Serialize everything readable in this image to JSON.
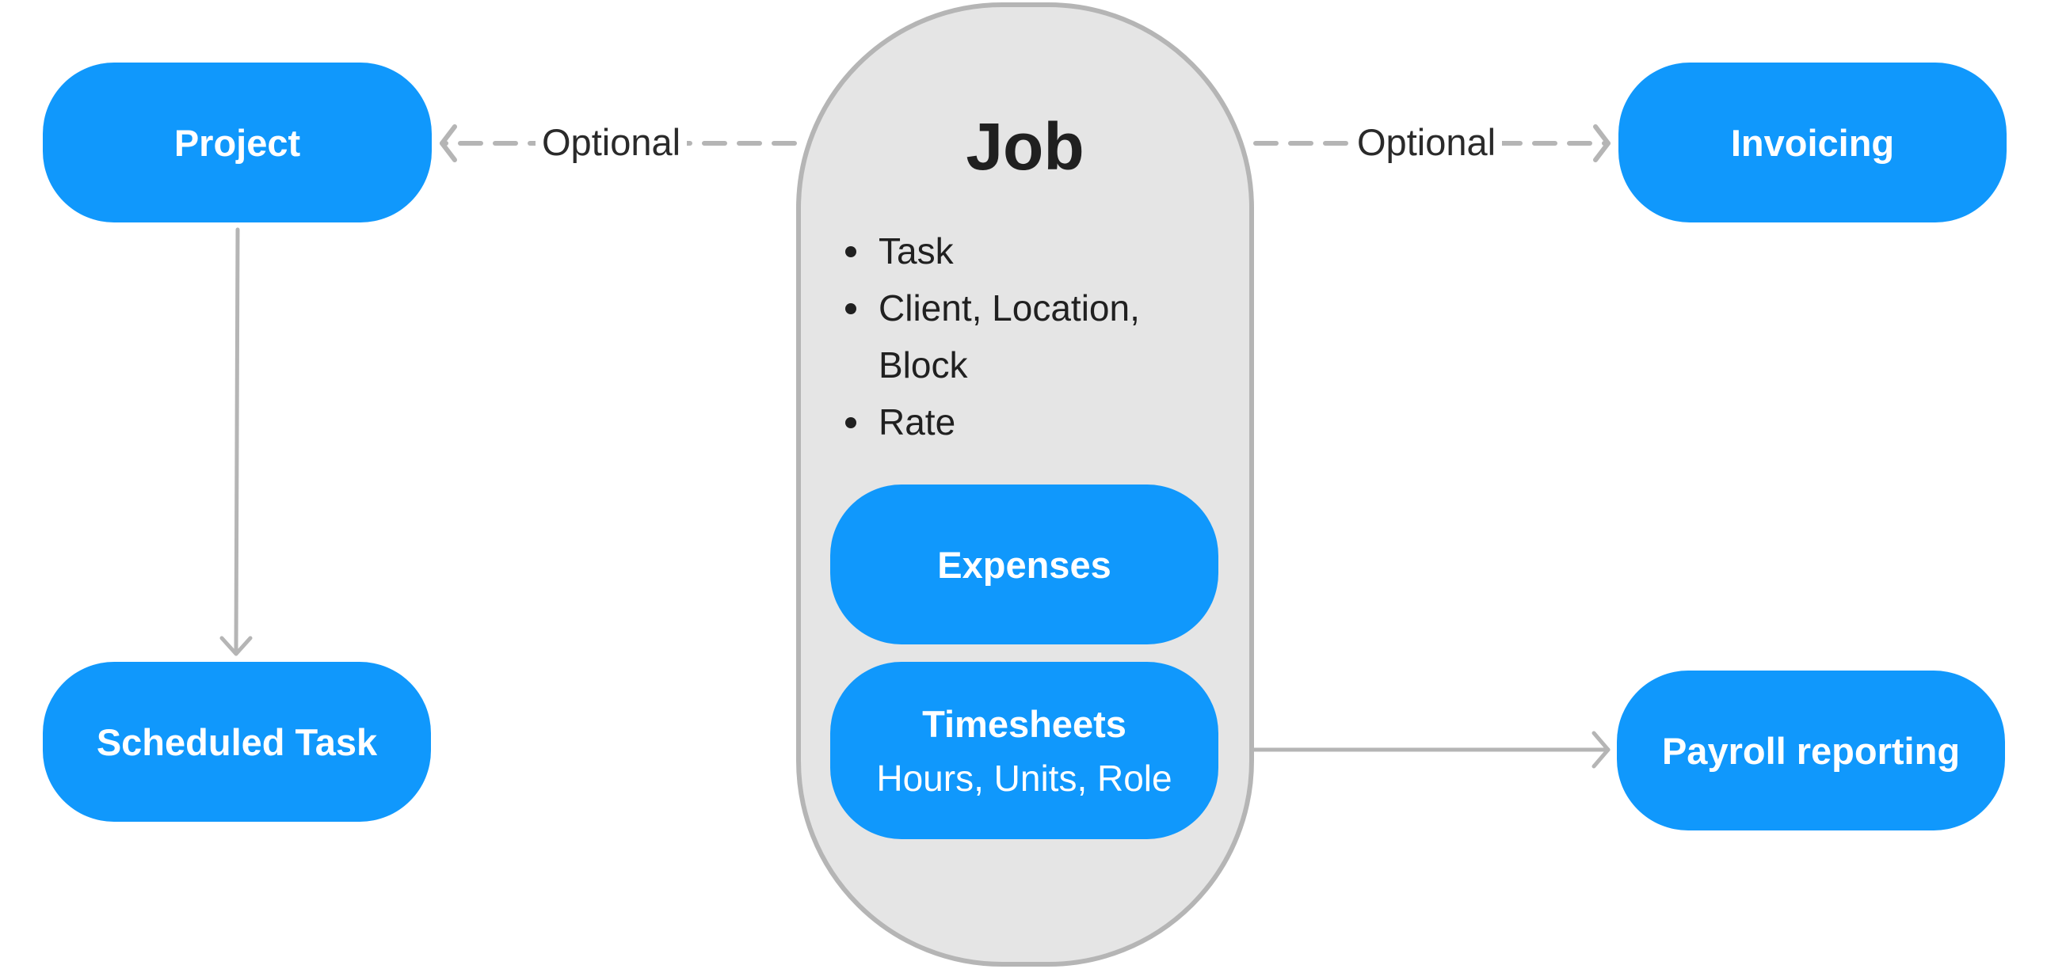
{
  "colors": {
    "node_fill": "#1098FC",
    "node_text": "#FFFFFF",
    "container_fill": "#E5E5E5",
    "container_border": "#B5B5B5",
    "edge": "#B5B5B5",
    "text": "#202020"
  },
  "nodes": {
    "project": "Project",
    "invoicing": "Invoicing",
    "scheduled_task": "Scheduled Task",
    "payroll": "Payroll reporting",
    "expenses": "Expenses",
    "timesheets": {
      "title": "Timesheets",
      "subtitle": "Hours, Units, Role"
    }
  },
  "job": {
    "title": "Job",
    "attributes": [
      "Task",
      "Client, Location, Block",
      "Rate"
    ]
  },
  "edges": [
    {
      "from": "job",
      "to": "project",
      "label": "Optional",
      "style": "dashed"
    },
    {
      "from": "job",
      "to": "invoicing",
      "label": "Optional",
      "style": "dashed"
    },
    {
      "from": "project",
      "to": "scheduled_task",
      "label": "",
      "style": "solid"
    },
    {
      "from": "timesheets",
      "to": "payroll",
      "label": "",
      "style": "solid"
    }
  ]
}
